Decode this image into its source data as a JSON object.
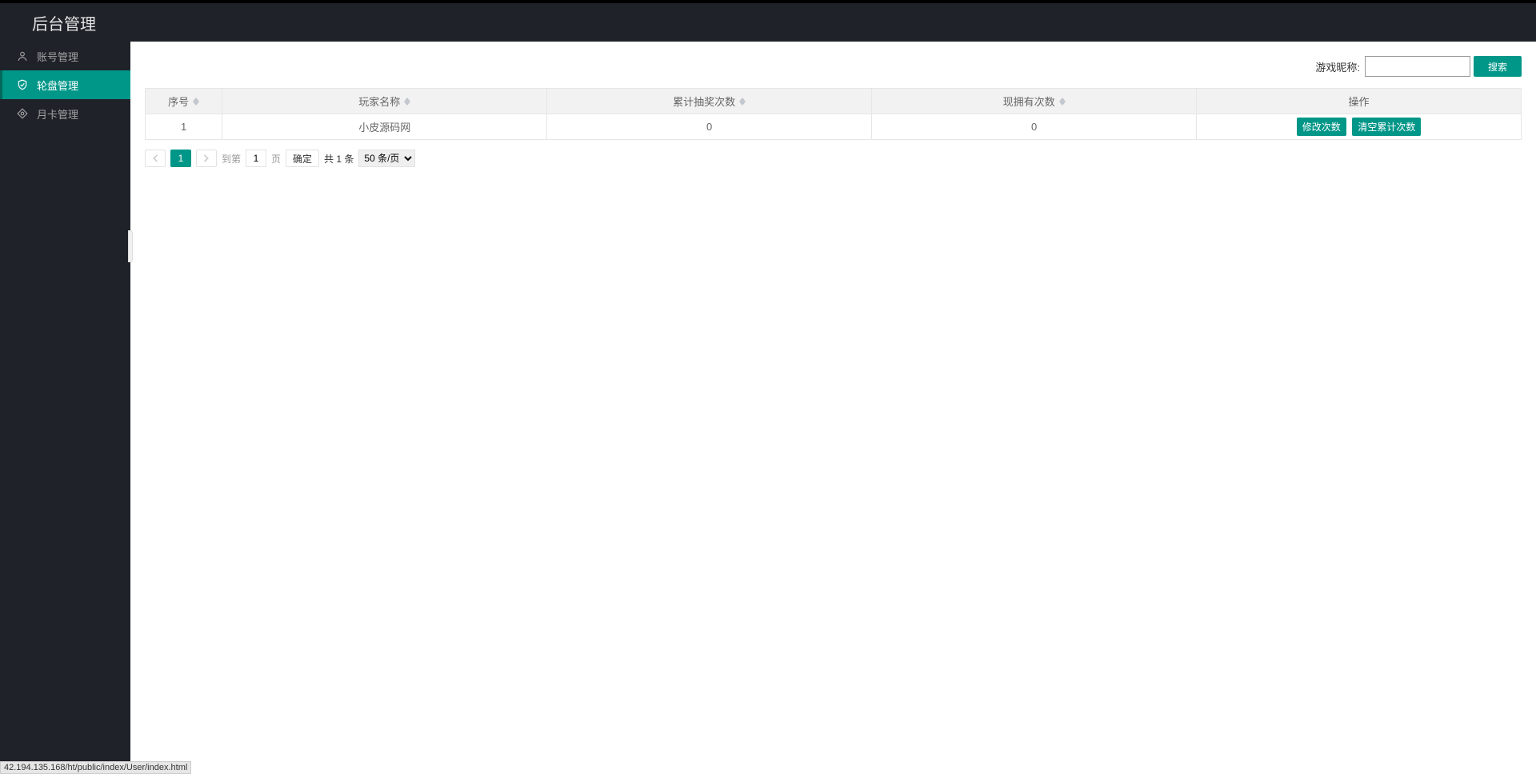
{
  "header": {
    "title": "后台管理"
  },
  "sidebar": {
    "items": [
      {
        "label": "账号管理"
      },
      {
        "label": "轮盘管理"
      },
      {
        "label": "月卡管理"
      }
    ]
  },
  "search": {
    "label": "游戏昵称:",
    "value": "",
    "button": "搜索"
  },
  "table": {
    "headers": {
      "col0": "序号",
      "col1": "玩家名称",
      "col2": "累计抽奖次数",
      "col3": "现拥有次数",
      "col4": "操作"
    },
    "row0": {
      "id": "1",
      "name": "小皮源码网",
      "total": "0",
      "current": "0"
    },
    "actions": {
      "edit": "修改次数",
      "clear": "清空累计次数"
    }
  },
  "pagination": {
    "current": "1",
    "goto_prefix": "到第",
    "goto_value": "1",
    "goto_suffix": "页",
    "confirm": "确定",
    "total": "共 1 条",
    "pagesize": "50 条/页"
  },
  "statusbar": "42.194.135.168/ht/public/index/User/index.html"
}
